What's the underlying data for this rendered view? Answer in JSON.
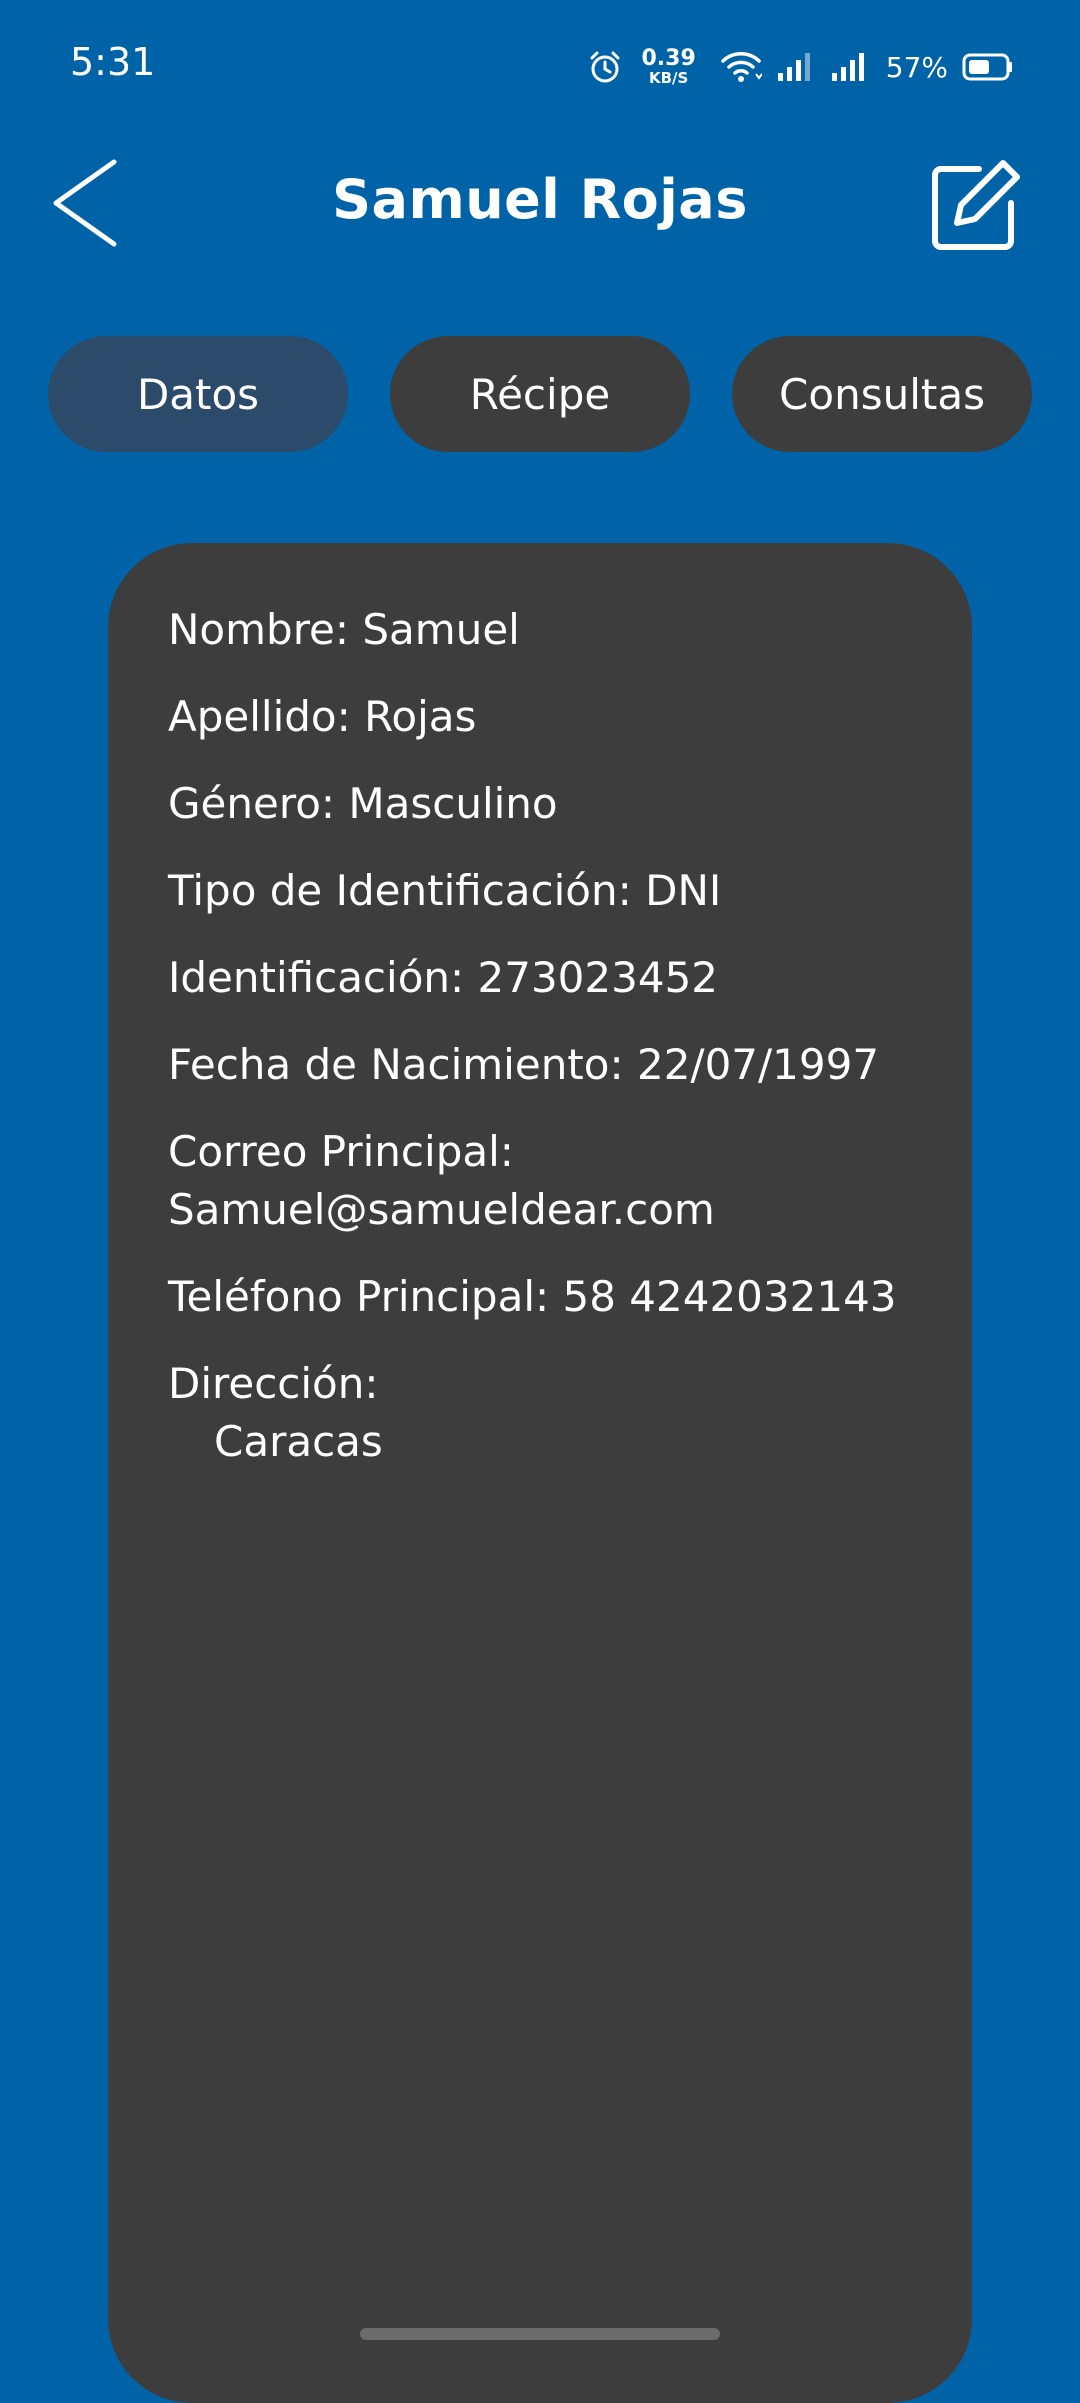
{
  "status_bar": {
    "time": "5:31",
    "net_speed_value": "0.39",
    "net_speed_unit": "KB/S",
    "battery_percent": "57%",
    "icons": [
      "alarm-icon",
      "wifi-icon",
      "signal-icon",
      "signal-icon",
      "battery-icon"
    ]
  },
  "header": {
    "title": "Samuel Rojas",
    "back_icon": "chevron-left-icon",
    "edit_icon": "edit-icon"
  },
  "tabs": [
    {
      "label": "Datos",
      "active": true
    },
    {
      "label": "Récipe",
      "active": false
    },
    {
      "label": "Consultas",
      "active": false
    }
  ],
  "details": {
    "nombre": {
      "label": "Nombre:",
      "value": "Samuel"
    },
    "apellido": {
      "label": "Apellido:",
      "value": "Rojas"
    },
    "genero": {
      "label": "Género:",
      "value": "Masculino"
    },
    "tipo_id": {
      "label": "Tipo de Identificación:",
      "value": "DNI"
    },
    "identificacion": {
      "label": "Identificación:",
      "value": "273023452"
    },
    "fecha_nacimiento": {
      "label": "Fecha de Nacimiento:",
      "value": "22/07/1997"
    },
    "correo": {
      "label": "Correo Principal:",
      "value": "Samuel@samueldear.com"
    },
    "telefono": {
      "label": "Teléfono Principal:",
      "value": "58 4242032143"
    },
    "direccion": {
      "label": "Dirección:",
      "value": "Caracas"
    }
  },
  "colors": {
    "background": "#0063a8",
    "card": "#3d3d3d",
    "tab_inactive": "#3d3d3d",
    "tab_active": "#2c4b6a",
    "text": "#ffffff"
  }
}
